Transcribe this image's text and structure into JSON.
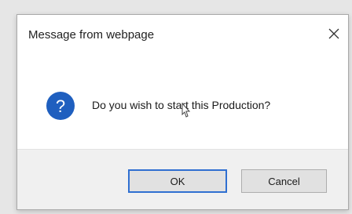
{
  "dialog": {
    "title": "Message from webpage",
    "message": "Do you wish to start this Production?",
    "buttons": {
      "ok_label": "OK",
      "cancel_label": "Cancel"
    },
    "icon": "question-icon",
    "close_icon": "close-icon",
    "accent_color": "#1f5fbf"
  },
  "cursor": {
    "type": "text-select-cursor"
  }
}
